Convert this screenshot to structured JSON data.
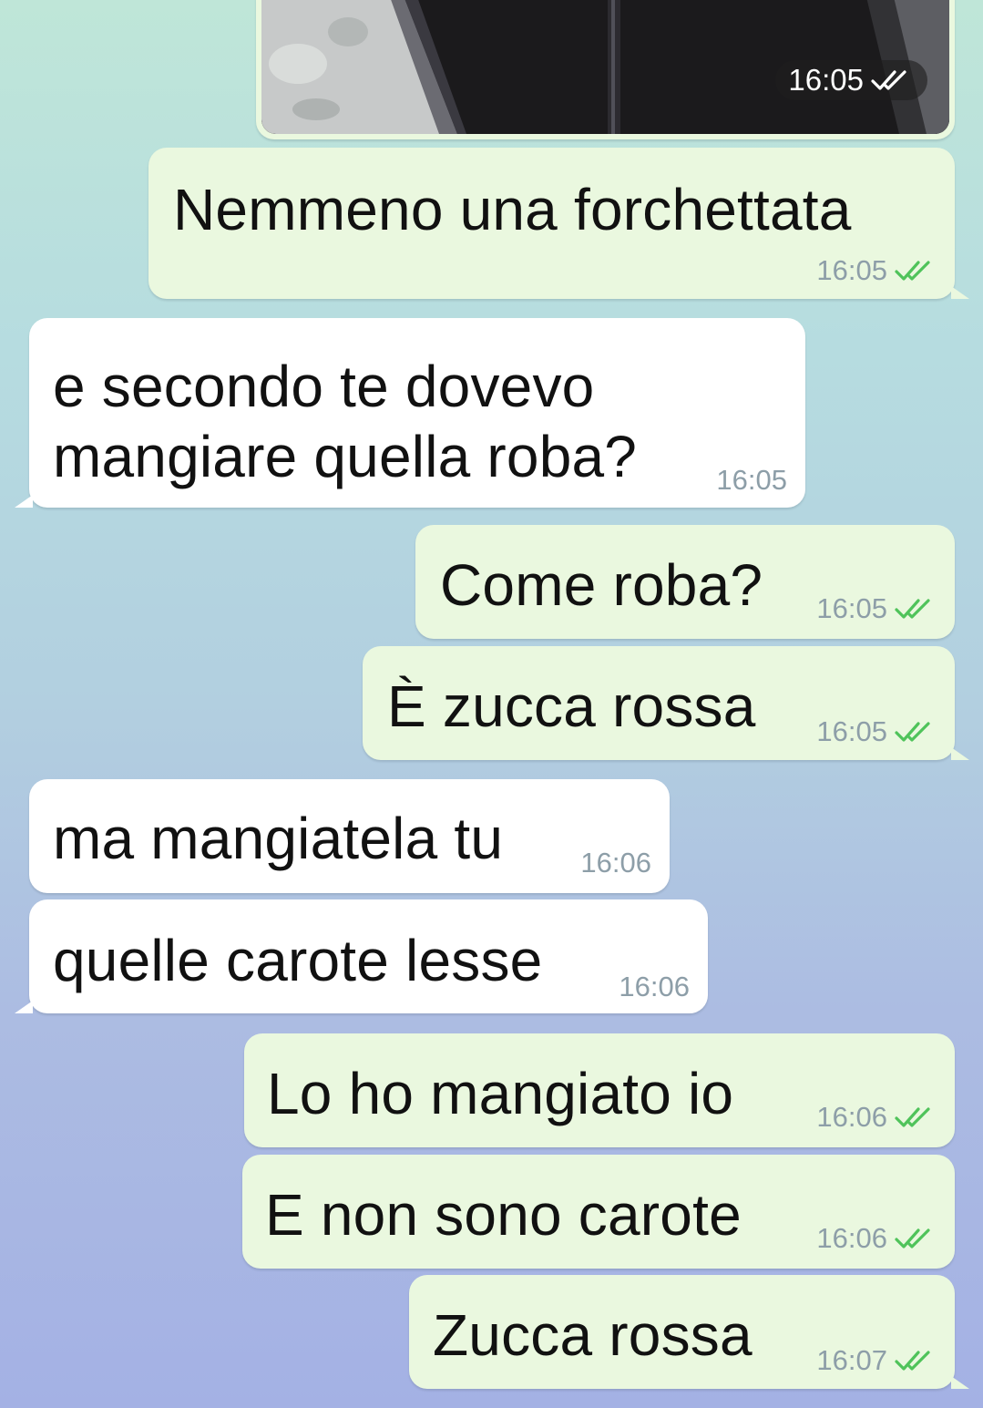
{
  "chat": {
    "photo": {
      "time": "16:05",
      "status": "read"
    },
    "messages": [
      {
        "text": "Nemmeno una forchettata",
        "time": "16:05",
        "direction": "outgoing",
        "status": "read"
      },
      {
        "text_lines": [
          "e secondo te dovevo",
          "mangiare quella roba?"
        ],
        "time": "16:05",
        "direction": "incoming"
      },
      {
        "text": "Come roba?",
        "time": "16:05",
        "direction": "outgoing",
        "status": "read"
      },
      {
        "text": "È zucca rossa",
        "time": "16:05",
        "direction": "outgoing",
        "status": "read"
      },
      {
        "text": "ma mangiatela tu",
        "time": "16:06",
        "direction": "incoming"
      },
      {
        "text": "quelle carote lesse",
        "time": "16:06",
        "direction": "incoming"
      },
      {
        "text": "Lo ho mangiato io",
        "time": "16:06",
        "direction": "outgoing",
        "status": "read"
      },
      {
        "text": "E non sono carote",
        "time": "16:06",
        "direction": "outgoing",
        "status": "read"
      },
      {
        "text": "Zucca rossa",
        "time": "16:07",
        "direction": "outgoing",
        "status": "read"
      }
    ]
  },
  "colors": {
    "outgoing_bubble": "#eaf8df",
    "incoming_bubble": "#ffffff",
    "read_tick": "#4fc35a",
    "timestamp": "#8d9ea8"
  },
  "icons": {
    "read_receipt": "double-check-icon"
  }
}
